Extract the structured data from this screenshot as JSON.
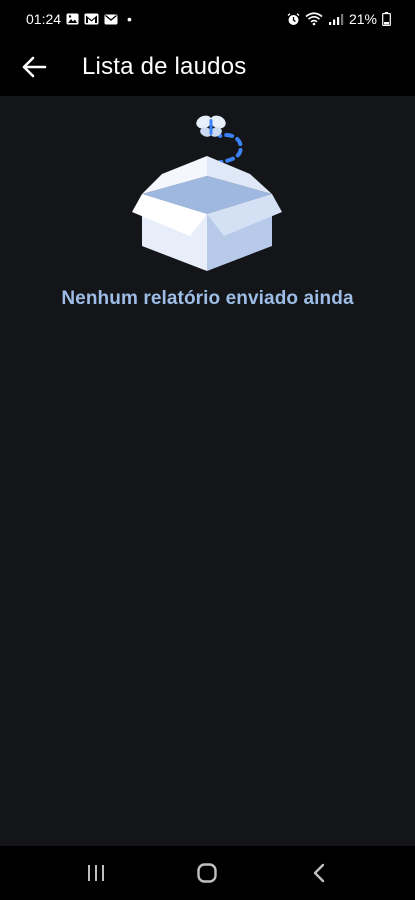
{
  "status_bar": {
    "time": "01:24",
    "dot": "•",
    "battery": "21%",
    "icons_left": [
      "image-icon",
      "gmail-icon",
      "mail-icon"
    ],
    "icons_right": [
      "alarm-icon",
      "wifi-icon",
      "signal-icon",
      "battery-icon"
    ]
  },
  "app_bar": {
    "title": "Lista de laudos",
    "back_icon": "arrow-left-icon"
  },
  "empty_state": {
    "illustration": "open-box-with-butterfly",
    "message": "Nenhum relatório enviado ainda"
  },
  "nav_bar": {
    "buttons": [
      "recent-apps",
      "home",
      "back"
    ]
  },
  "colors": {
    "app_bar": "#000000",
    "background": "#141518",
    "message": "#9dbde6",
    "accent": "#3b82f6"
  }
}
